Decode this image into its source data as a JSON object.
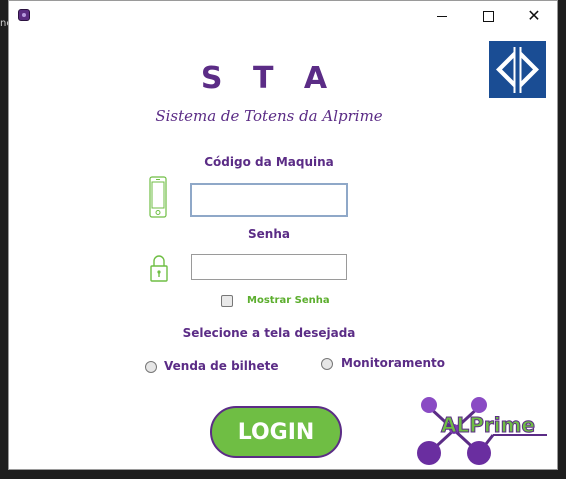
{
  "edge_text": "ne",
  "window": {
    "minimize_symbol": "",
    "close_symbol": "✕"
  },
  "header": {
    "title": "S T A",
    "subtitle": "Sistema de Totens da Alprime"
  },
  "form": {
    "code_label": "Código da Maquina",
    "code_value": "",
    "password_label": "Senha",
    "password_value": "",
    "show_password_label": "Mostrar Senha",
    "show_password_checked": false,
    "select_label": "Selecione a tela desejada",
    "options": [
      {
        "label": "Venda de bilhete",
        "selected": false
      },
      {
        "label": "Monitoramento",
        "selected": false
      }
    ],
    "login_label": "LOGIN"
  },
  "brand": {
    "logo_text": "ALPrime",
    "colors": {
      "purple": "#5b2c86",
      "green": "#6fbe44",
      "metro_blue": "#1a4d94"
    }
  },
  "icons": [
    "app-icon",
    "metro-logo-icon",
    "phone-icon",
    "lock-icon",
    "alprime-logo-icon"
  ]
}
